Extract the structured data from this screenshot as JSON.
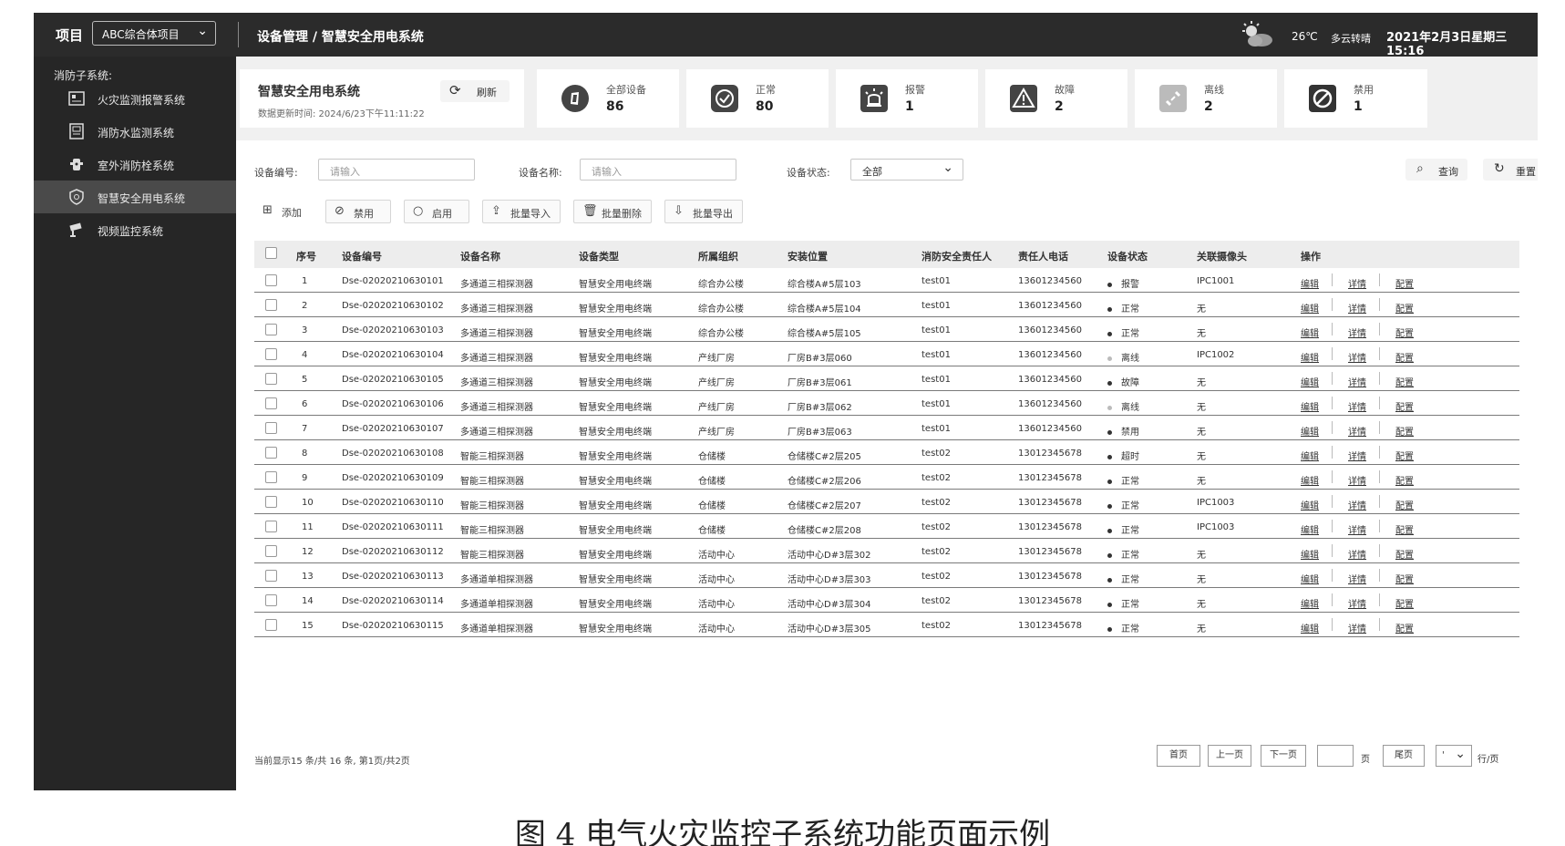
{
  "topbar": {
    "project_label": "项目",
    "project_select": "ABC综合体项目",
    "breadcrumb": "设备管理 / 智慧安全用电系统",
    "temperature": "26℃",
    "weather": "多云转晴",
    "datetime": "2021年2月3日星期三 15:16"
  },
  "sidebar": {
    "section_title": "消防子系统:",
    "items": [
      {
        "label": "火灾监测报警系统",
        "icon": "alarm-panel-icon"
      },
      {
        "label": "消防水监测系统",
        "icon": "water-monitor-icon"
      },
      {
        "label": "室外消防栓系统",
        "icon": "hydrant-icon"
      },
      {
        "label": "智慧安全用电系统",
        "icon": "shield-icon",
        "active": true
      },
      {
        "label": "视频监控系统",
        "icon": "camera-icon"
      }
    ]
  },
  "header": {
    "title": "智慧安全用电系统",
    "refresh_label": "刷新",
    "updated_text": "数据更新时间:  2024/6/23下午11:11:22"
  },
  "stats": [
    {
      "label": "全部设备",
      "value": "86",
      "icon": "device-icon"
    },
    {
      "label": "正常",
      "value": "80",
      "icon": "check-icon"
    },
    {
      "label": "报警",
      "value": "1",
      "icon": "alarm-light-icon"
    },
    {
      "label": "故障",
      "value": "2",
      "icon": "warning-icon"
    },
    {
      "label": "离线",
      "value": "2",
      "icon": "broken-link-icon"
    },
    {
      "label": "禁用",
      "value": "1",
      "icon": "forbidden-icon"
    }
  ],
  "filters": {
    "device_no_label": "设备编号:",
    "device_no_placeholder": "请输入",
    "device_name_label": "设备名称:",
    "device_name_placeholder": "请输入",
    "status_label": "设备状态:",
    "status_value": "全部",
    "search_label": "查询",
    "reset_label": "重置"
  },
  "actions": [
    {
      "label": "添加",
      "icon": "plus-icon"
    },
    {
      "label": "禁用",
      "icon": "ban-icon"
    },
    {
      "label": "启用",
      "icon": "circle-icon"
    },
    {
      "label": "批量导入",
      "icon": "upload-icon"
    },
    {
      "label": "批量删除",
      "icon": "trash-icon"
    },
    {
      "label": "批量导出",
      "icon": "download-icon"
    }
  ],
  "table": {
    "headers": [
      "序号",
      "设备编号",
      "设备名称",
      "设备类型",
      "所属组织",
      "安装位置",
      "消防安全责任人",
      "责任人电话",
      "设备状态",
      "关联摄像头",
      "操作"
    ],
    "op_labels": [
      "编辑",
      "详情",
      "配置"
    ],
    "rows": [
      [
        "1",
        "Dse-02020210630101",
        "多通道三相探测器",
        "智慧安全用电终端",
        "综合办公楼",
        "综合楼A#5层103",
        "test01",
        "13601234560",
        "报警",
        "IPC1001"
      ],
      [
        "2",
        "Dse-02020210630102",
        "多通道三相探测器",
        "智慧安全用电终端",
        "综合办公楼",
        "综合楼A#5层104",
        "test01",
        "13601234560",
        "正常",
        "无"
      ],
      [
        "3",
        "Dse-02020210630103",
        "多通道三相探测器",
        "智慧安全用电终端",
        "综合办公楼",
        "综合楼A#5层105",
        "test01",
        "13601234560",
        "正常",
        "无"
      ],
      [
        "4",
        "Dse-02020210630104",
        "多通道三相探测器",
        "智慧安全用电终端",
        "产线厂房",
        "厂房B#3层060",
        "test01",
        "13601234560",
        "离线",
        "IPC1002"
      ],
      [
        "5",
        "Dse-02020210630105",
        "多通道三相探测器",
        "智慧安全用电终端",
        "产线厂房",
        "厂房B#3层061",
        "test01",
        "13601234560",
        "故障",
        "无"
      ],
      [
        "6",
        "Dse-02020210630106",
        "多通道三相探测器",
        "智慧安全用电终端",
        "产线厂房",
        "厂房B#3层062",
        "test01",
        "13601234560",
        "离线",
        "无"
      ],
      [
        "7",
        "Dse-02020210630107",
        "多通道三相探测器",
        "智慧安全用电终端",
        "产线厂房",
        "厂房B#3层063",
        "test01",
        "13601234560",
        "禁用",
        "无"
      ],
      [
        "8",
        "Dse-02020210630108",
        "智能三相探测器",
        "智慧安全用电终端",
        "仓储楼",
        "仓储楼C#2层205",
        "test02",
        "13012345678",
        "超时",
        "无"
      ],
      [
        "9",
        "Dse-02020210630109",
        "智能三相探测器",
        "智慧安全用电终端",
        "仓储楼",
        "仓储楼C#2层206",
        "test02",
        "13012345678",
        "正常",
        "无"
      ],
      [
        "10",
        "Dse-02020210630110",
        "智能三相探测器",
        "智慧安全用电终端",
        "仓储楼",
        "仓储楼C#2层207",
        "test02",
        "13012345678",
        "正常",
        "IPC1003"
      ],
      [
        "11",
        "Dse-02020210630111",
        "智能三相探测器",
        "智慧安全用电终端",
        "仓储楼",
        "仓储楼C#2层208",
        "test02",
        "13012345678",
        "正常",
        "IPC1003"
      ],
      [
        "12",
        "Dse-02020210630112",
        "智能三相探测器",
        "智慧安全用电终端",
        "活动中心",
        "活动中心D#3层302",
        "test02",
        "13012345678",
        "正常",
        "无"
      ],
      [
        "13",
        "Dse-02020210630113",
        "多通道单相探测器",
        "智慧安全用电终端",
        "活动中心",
        "活动中心D#3层303",
        "test02",
        "13012345678",
        "正常",
        "无"
      ],
      [
        "14",
        "Dse-02020210630114",
        "多通道单相探测器",
        "智慧安全用电终端",
        "活动中心",
        "活动中心D#3层304",
        "test02",
        "13012345678",
        "正常",
        "无"
      ],
      [
        "15",
        "Dse-02020210630115",
        "多通道单相探测器",
        "智慧安全用电终端",
        "活动中心",
        "活动中心D#3层305",
        "test02",
        "13012345678",
        "正常",
        "无"
      ]
    ]
  },
  "pagination": {
    "info": "当前显示15 条/共 16 条, 第1页/共2页",
    "first": "首页",
    "prev": "上一页",
    "next": "下一页",
    "page_unit": "页",
    "last": "尾页",
    "per_page_value": "'",
    "per_page_unit": "行/页"
  },
  "caption": "图 4   电气火灾监控子系统功能页面示例"
}
